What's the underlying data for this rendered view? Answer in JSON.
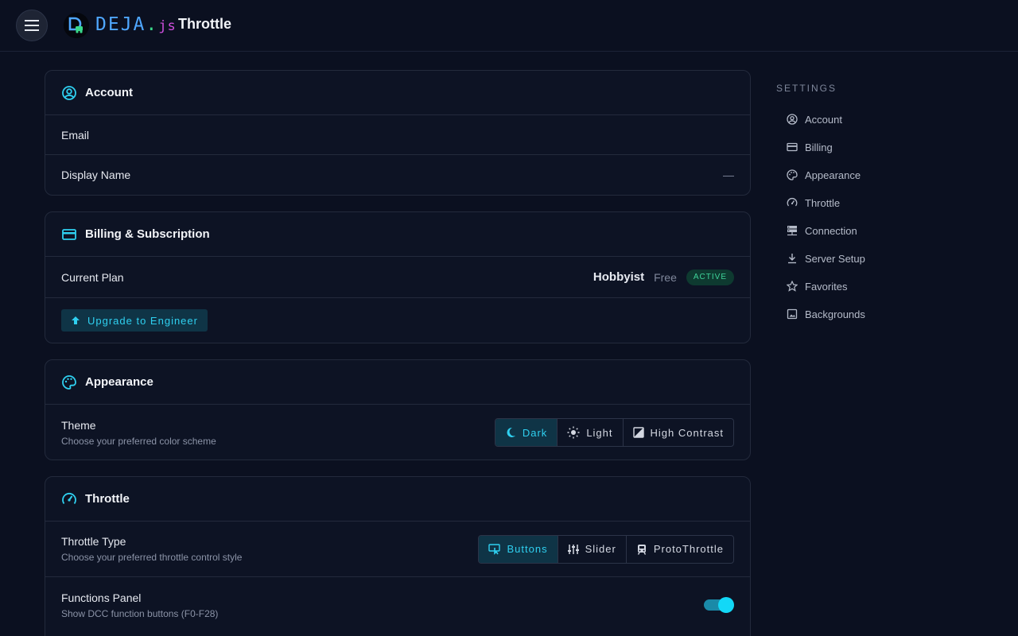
{
  "header": {
    "brand_main": "DEJA",
    "brand_dot": ".",
    "brand_js": "js",
    "title": "Throttle"
  },
  "account": {
    "title": "Account",
    "email_label": "Email",
    "display_name_label": "Display Name",
    "display_name_value": "—"
  },
  "billing": {
    "title": "Billing & Subscription",
    "current_plan_label": "Current Plan",
    "plan_name": "Hobbyist",
    "plan_price": "Free",
    "plan_status": "ACTIVE",
    "upgrade_label": "Upgrade to Engineer"
  },
  "appearance": {
    "title": "Appearance",
    "theme_label": "Theme",
    "theme_sub": "Choose your preferred color scheme",
    "options": [
      "Dark",
      "Light",
      "High Contrast"
    ],
    "selected": "Dark"
  },
  "throttle": {
    "title": "Throttle",
    "type_label": "Throttle Type",
    "type_sub": "Choose your preferred throttle control style",
    "options": [
      "Buttons",
      "Slider",
      "ProtoThrottle"
    ],
    "selected": "Buttons",
    "functions_label": "Functions Panel",
    "functions_sub": "Show DCC function buttons (F0-F28)",
    "functions_enabled": true
  },
  "sidebar": {
    "heading": "SETTINGS",
    "items": [
      "Account",
      "Billing",
      "Appearance",
      "Throttle",
      "Connection",
      "Server Setup",
      "Favorites",
      "Backgrounds"
    ]
  },
  "colors": {
    "background": "#0b1020",
    "card": "#0d1324",
    "accent": "#2fd0f0",
    "active_badge": "#3fd39a",
    "brand_blue": "#4fa7ff",
    "brand_pink": "#d14fe0"
  }
}
